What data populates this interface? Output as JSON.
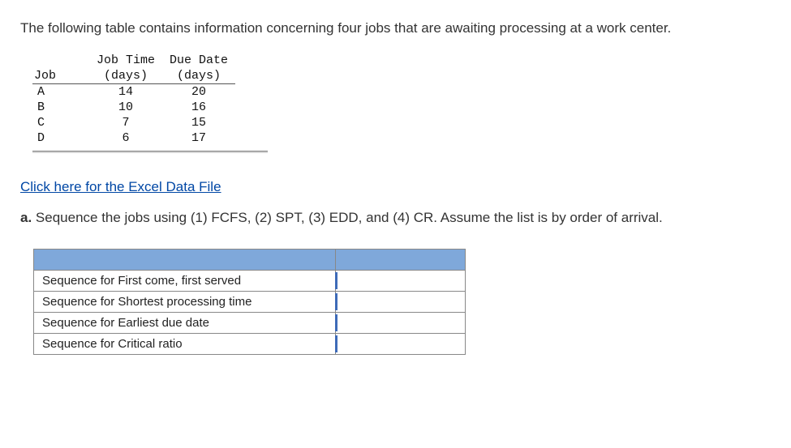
{
  "intro": "The following table contains information concerning four jobs that are awaiting processing at a work center.",
  "data_table": {
    "headers": {
      "job": "Job",
      "job_time_top": "Job Time",
      "job_time_sub": "(days)",
      "due_date_top": "Due Date",
      "due_date_sub": "(days)"
    },
    "rows": [
      {
        "job": "A",
        "time": "14",
        "due": "20"
      },
      {
        "job": "B",
        "time": "10",
        "due": "16"
      },
      {
        "job": "C",
        "time": "7",
        "due": "15"
      },
      {
        "job": "D",
        "time": "6",
        "due": "17"
      }
    ]
  },
  "excel_link": "Click here for the Excel Data File",
  "question_a_label": "a.",
  "question_a_text": " Sequence the jobs using (1) FCFS, (2) SPT, (3) EDD, and (4) CR. Assume the list is by order of arrival.",
  "answer_rows": [
    {
      "label": "Sequence for First come, first served",
      "value": ""
    },
    {
      "label": "Sequence for Shortest processing time",
      "value": ""
    },
    {
      "label": "Sequence for Earliest due date",
      "value": ""
    },
    {
      "label": "Sequence for Critical ratio",
      "value": ""
    }
  ],
  "chart_data": {
    "type": "table",
    "title": "Job processing data",
    "columns": [
      "Job",
      "Job Time (days)",
      "Due Date (days)"
    ],
    "rows": [
      [
        "A",
        14,
        20
      ],
      [
        "B",
        10,
        16
      ],
      [
        "C",
        7,
        15
      ],
      [
        "D",
        6,
        17
      ]
    ]
  }
}
